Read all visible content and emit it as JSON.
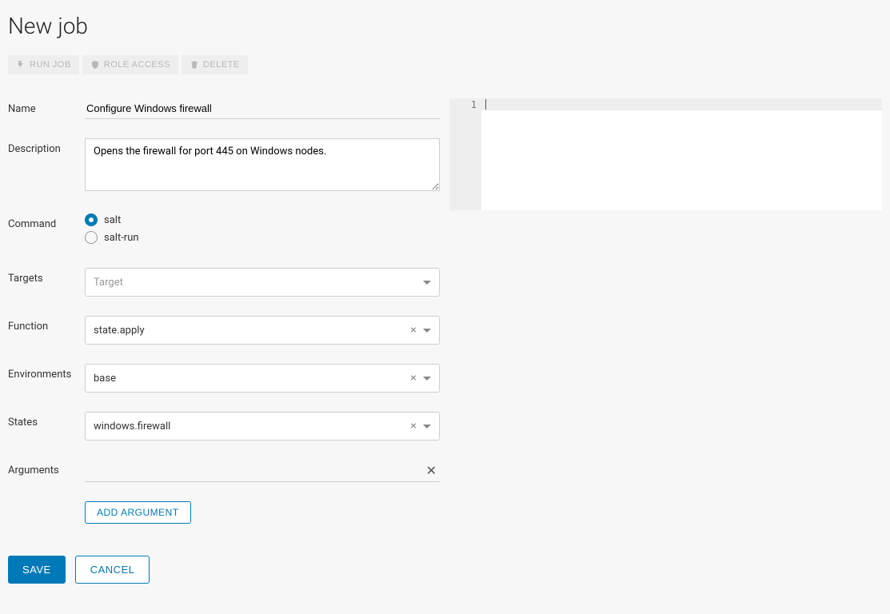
{
  "page": {
    "title": "New job"
  },
  "toolbar": {
    "run_job": "RUN JOB",
    "role_access": "ROLE ACCESS",
    "delete": "DELETE"
  },
  "labels": {
    "name": "Name",
    "description": "Description",
    "command": "Command",
    "targets": "Targets",
    "function": "Function",
    "environments": "Environments",
    "states": "States",
    "arguments": "Arguments"
  },
  "form": {
    "name": "Configure Windows firewall",
    "description": "Opens the firewall for port 445 on Windows nodes.",
    "command": {
      "selected": "salt",
      "options": {
        "salt": "salt",
        "salt_run": "salt-run"
      }
    },
    "targets": {
      "value": "",
      "placeholder": "Target"
    },
    "function": {
      "value": "state.apply"
    },
    "environments": {
      "value": "base"
    },
    "states": {
      "value": "windows.firewall"
    },
    "arguments": [
      {
        "value": ""
      }
    ],
    "add_argument_label": "ADD ARGUMENT"
  },
  "editor": {
    "line_numbers": [
      "1"
    ]
  },
  "footer": {
    "save": "SAVE",
    "cancel": "CANCEL"
  }
}
